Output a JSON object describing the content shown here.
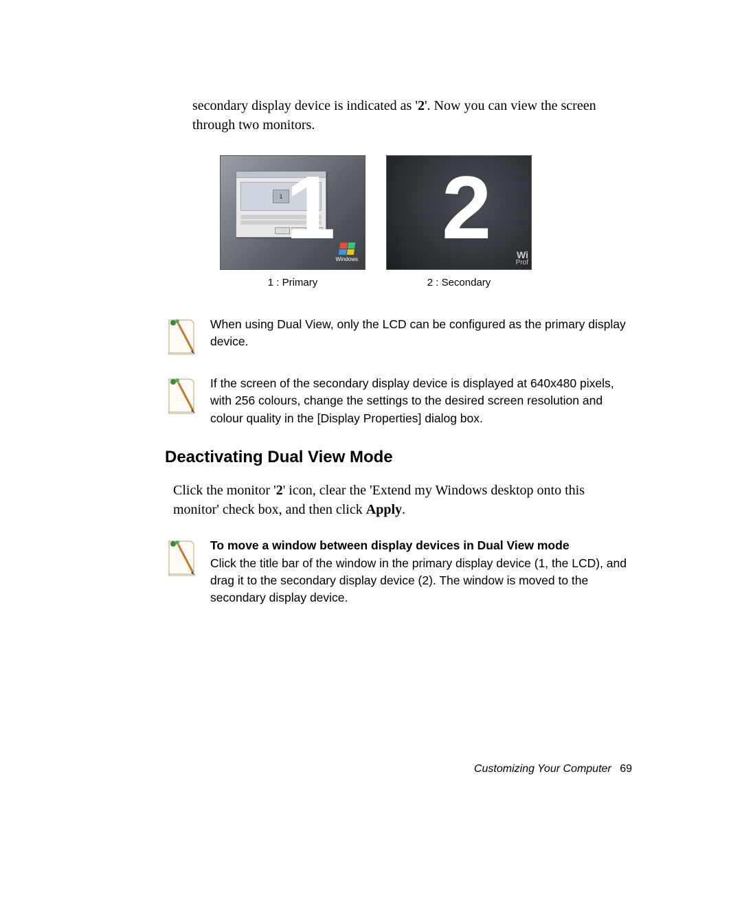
{
  "intro": {
    "text_before": "secondary display device is indicated as '",
    "icon_number": "2",
    "text_after": "'. Now you can view the screen through two monitors."
  },
  "figures": {
    "primary_number": "1",
    "secondary_number": "2",
    "primary_caption": "1 : Primary",
    "secondary_caption": "2 : Secondary",
    "windows_label": "Windows",
    "wi_label": "Wi",
    "prof_label": "Prof"
  },
  "note1": "When using Dual View, only the LCD can be configured as the primary display device.",
  "note2": "If the screen of the secondary display device is displayed at 640x480 pixels, with 256 colours, change the settings to the desired screen resolution and colour quality in the [Display Properties] dialog box.",
  "section_heading": "Deactivating Dual View Mode",
  "body": {
    "p1_a": "Click the monitor '",
    "p1_num": "2",
    "p1_b": "' icon, clear the 'Extend my Windows desktop onto this monitor' check box, and then click ",
    "p1_apply": "Apply",
    "p1_c": "."
  },
  "note3": {
    "title": "To move a window between display devices in Dual View mode",
    "text": "Click the title bar of the window in the primary display device (1, the LCD), and drag it to the secondary display device (2). The window is moved to the secondary display device."
  },
  "footer": {
    "label": "Customizing Your Computer",
    "page": "69"
  }
}
